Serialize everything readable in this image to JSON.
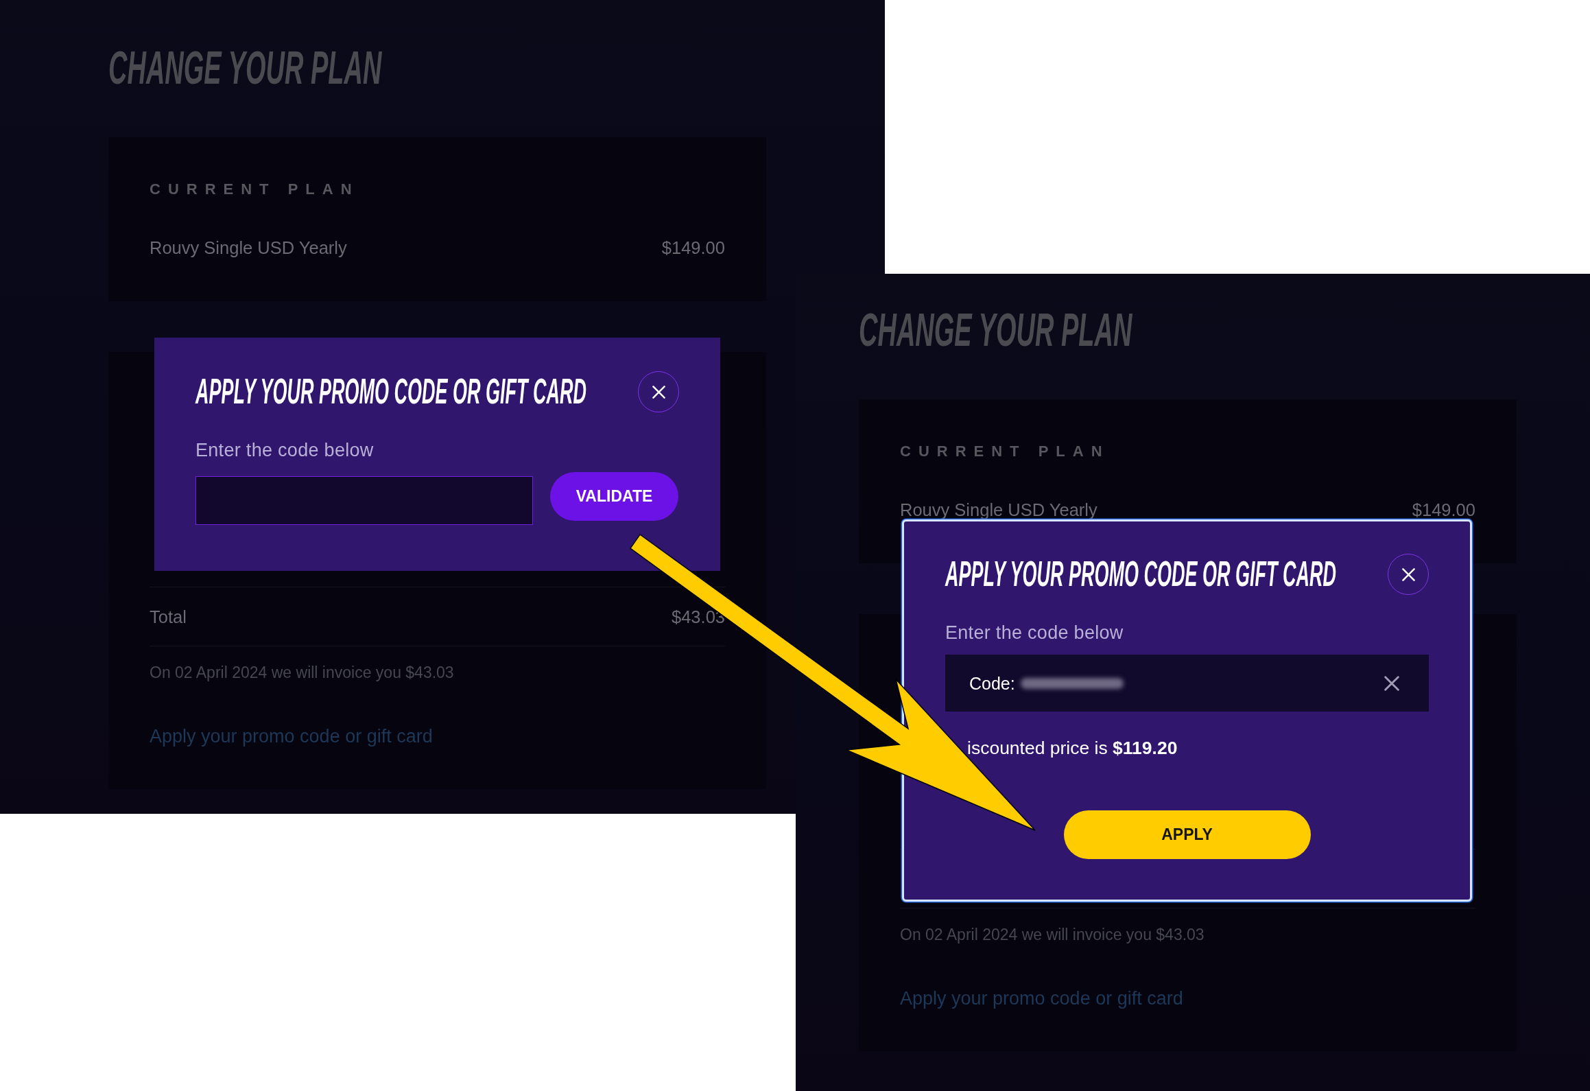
{
  "screenshots": [
    {
      "page": {
        "title": "CHANGE YOUR PLAN",
        "current_plan": {
          "heading": "CURRENT PLAN",
          "plan_name": "Rouvy Single USD Yearly",
          "price": "$149.00"
        },
        "summary": {
          "total": {
            "label": "Total",
            "amount": "$43.03"
          },
          "invoice_note": "On 02 April 2024 we will invoice you $43.03",
          "promo_link": "Apply your promo code or gift card"
        }
      },
      "dialog": {
        "title": "APPLY YOUR PROMO CODE OR GIFT CARD",
        "focused": false,
        "field_label": "Enter the code below",
        "field": {
          "kind": "empty"
        },
        "button": {
          "kind": "inline",
          "label": "VALIDATE"
        }
      }
    },
    {
      "page": {
        "title": "CHANGE YOUR PLAN",
        "current_plan": {
          "heading": "CURRENT PLAN",
          "plan_name": "Rouvy Single USD Yearly",
          "price": "$149.00"
        },
        "summary": {
          "invoice_note": "On 02 April 2024 we will invoice you $43.03",
          "promo_link": "Apply your promo code or gift card"
        }
      },
      "dialog": {
        "title": "APPLY YOUR PROMO CODE OR GIFT CARD",
        "focused": true,
        "field_label": "Enter the code below",
        "field": {
          "kind": "filled",
          "prefix": "Code:",
          "blurred": true
        },
        "message": "iscounted price is **$119.20**",
        "button": {
          "kind": "primary",
          "label": "APPLY"
        }
      }
    }
  ]
}
